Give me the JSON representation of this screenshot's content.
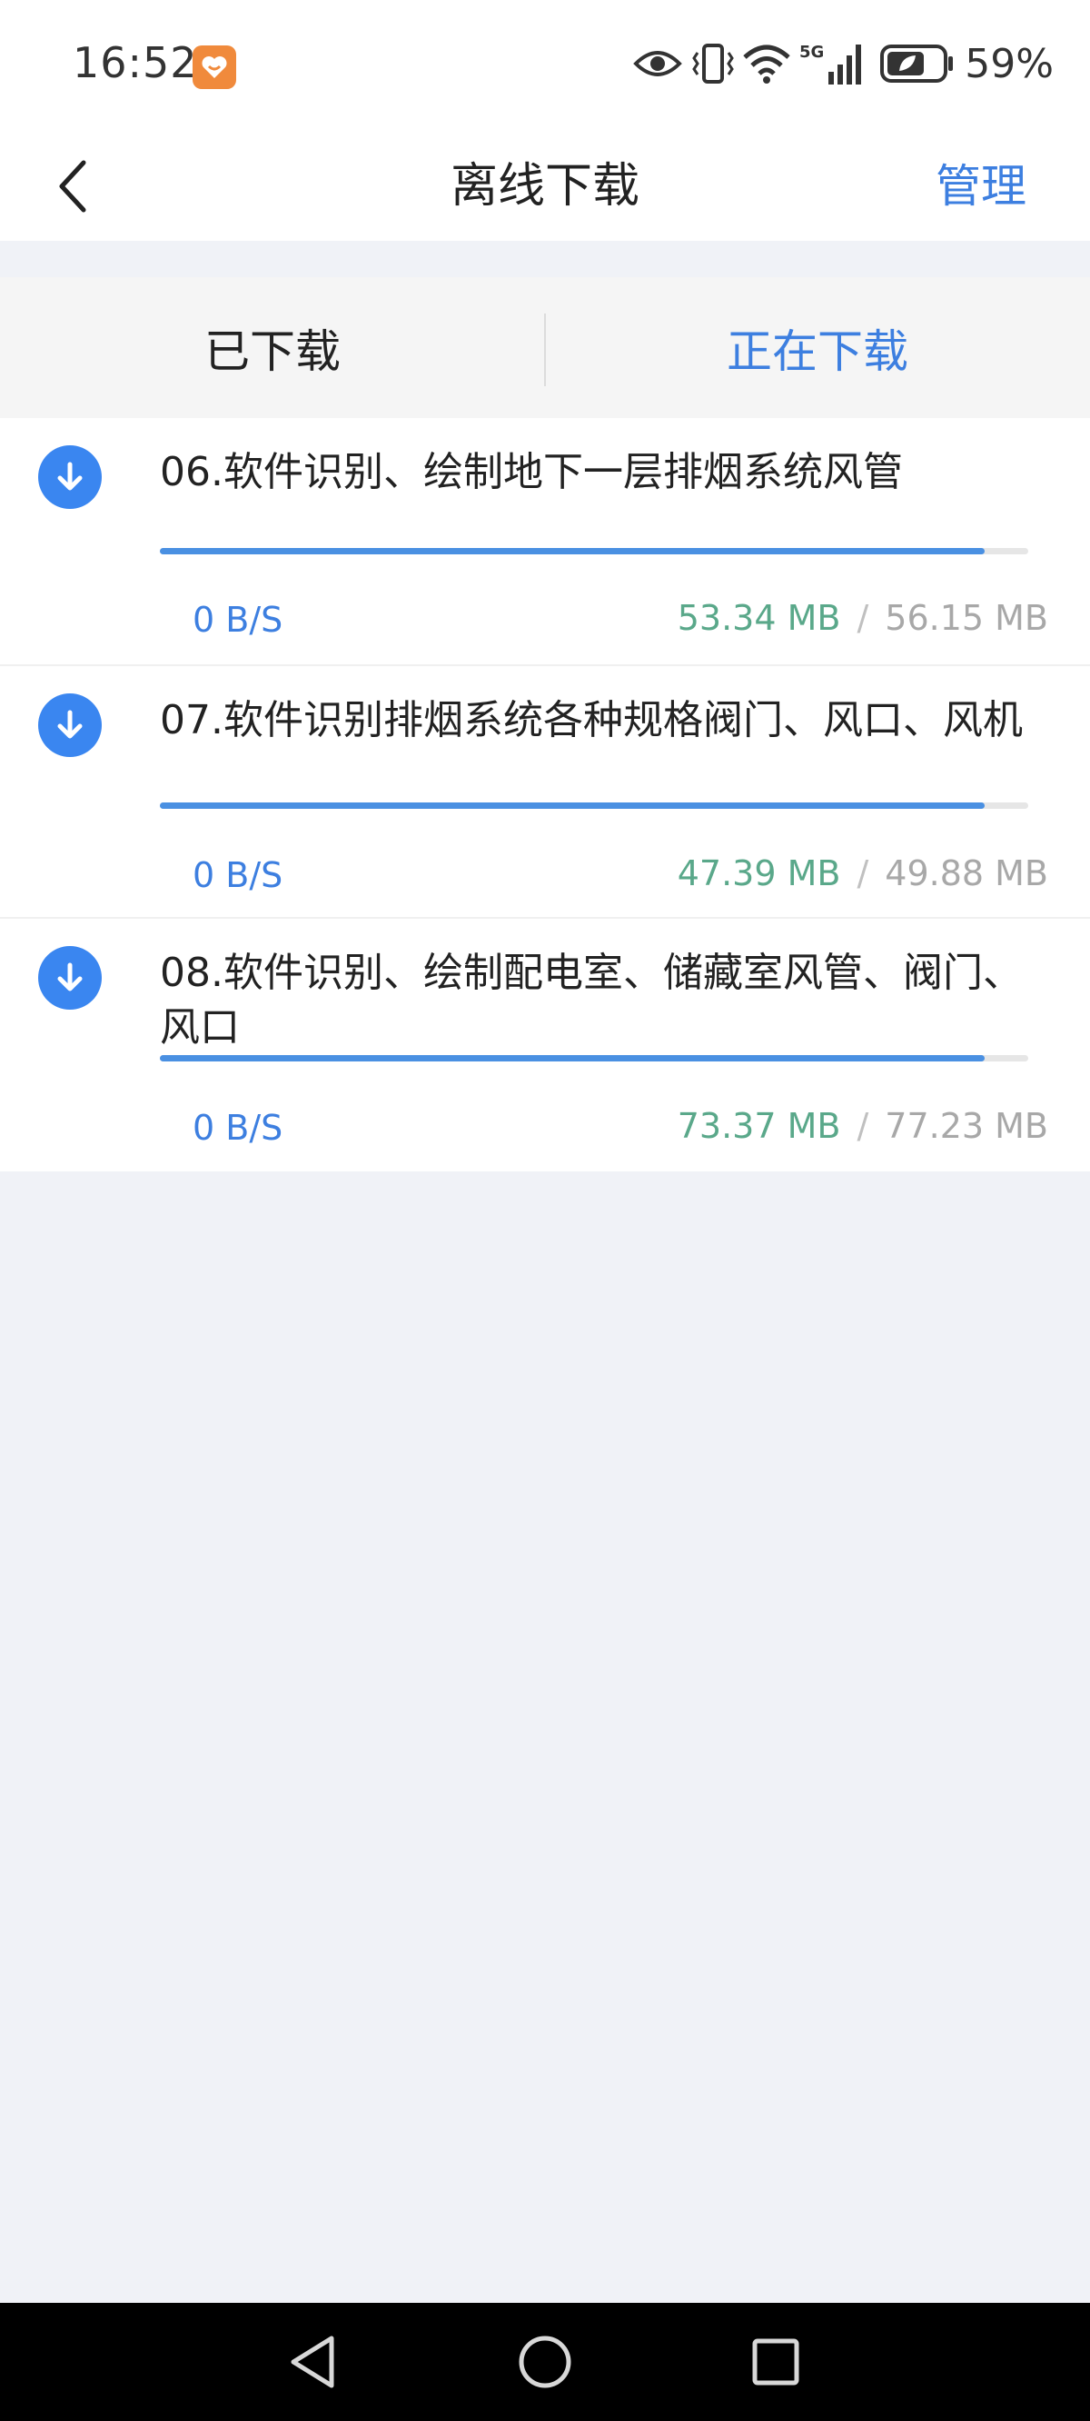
{
  "status_bar": {
    "time": "16:52",
    "battery_percent": "59%",
    "icons": [
      "app-notification-icon",
      "eye-icon",
      "vibrate-icon",
      "wifi-icon",
      "signal-5g-icon",
      "battery-icon"
    ],
    "app_icon_color": "#f08a3c"
  },
  "header": {
    "back_icon": "chevron-left-icon",
    "title": "离线下载",
    "manage_label": "管理"
  },
  "tabs": [
    {
      "label": "已下载",
      "active": false
    },
    {
      "label": "正在下载",
      "active": true
    }
  ],
  "downloads": [
    {
      "title": "06.软件识别、绘制地下一层排烟系统风管",
      "progress": 0.95,
      "speed": "0 B/S",
      "downloaded": "53.34 MB",
      "total": "56.15 MB"
    },
    {
      "title": "07.软件识别排烟系统各种规格阀门、风口、风机",
      "progress": 0.95,
      "speed": "0 B/S",
      "downloaded": "47.39 MB",
      "total": "49.88 MB"
    },
    {
      "title": "08.软件识别、绘制配电室、储藏室风管、阀门、风口",
      "progress": 0.95,
      "speed": "0 B/S",
      "downloaded": "73.37 MB",
      "total": "77.23 MB"
    }
  ],
  "size_separator": "/",
  "colors": {
    "accent": "#3d7fe0",
    "icon_blue": "#3a86f0",
    "downloaded_size": "#5aa88a",
    "total_size": "#a8a8a8",
    "background": "#f0f2f7"
  },
  "nav_bar": {
    "buttons": [
      "back-triangle-icon",
      "home-circle-icon",
      "recents-square-icon"
    ]
  }
}
